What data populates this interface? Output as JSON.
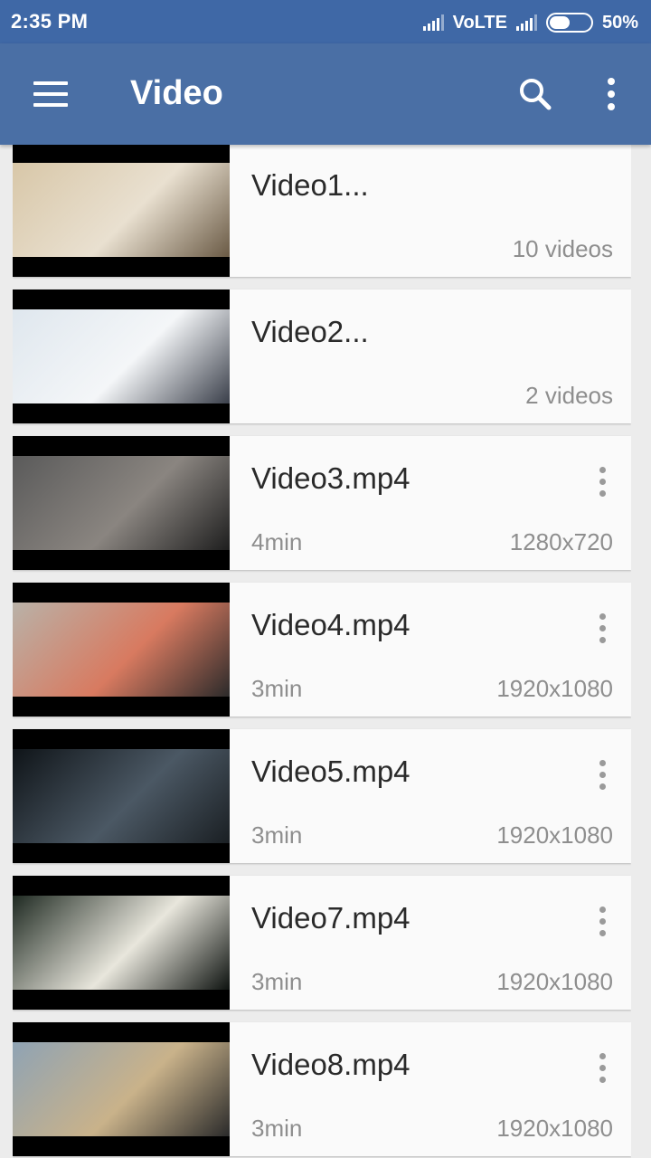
{
  "status_bar": {
    "time": "2:35 PM",
    "network": "VoLTE",
    "battery": "50%",
    "battery_level": 0.5
  },
  "app_bar": {
    "title": "Video",
    "menu_icon": "hamburger-menu-icon",
    "search_icon": "search-icon",
    "overflow_icon": "more-vert-icon"
  },
  "items": [
    {
      "title": "Video1...",
      "subtitle": "",
      "meta": "10 videos",
      "type": "folder",
      "colors": [
        "#d8c7a8",
        "#e9e0d0",
        "#6a5a45"
      ]
    },
    {
      "title": "Video2...",
      "subtitle": "",
      "meta": "2 videos",
      "type": "folder",
      "colors": [
        "#dfe7ee",
        "#f4f6f8",
        "#3a3f4a"
      ]
    },
    {
      "title": "Video3.mp4",
      "subtitle": "4min",
      "meta": "1280x720",
      "type": "file",
      "colors": [
        "#5a5a5a",
        "#8a8580",
        "#1e1e1e"
      ]
    },
    {
      "title": "Video4.mp4",
      "subtitle": "3min",
      "meta": "1920x1080",
      "type": "file",
      "colors": [
        "#b9b2a8",
        "#d87a60",
        "#2b2a2a"
      ]
    },
    {
      "title": "Video5.mp4",
      "subtitle": "3min",
      "meta": "1920x1080",
      "type": "file",
      "colors": [
        "#0f1418",
        "#4b5864",
        "#1a1f23"
      ]
    },
    {
      "title": "Video7.mp4",
      "subtitle": "3min",
      "meta": "1920x1080",
      "type": "file",
      "colors": [
        "#1f2a22",
        "#e8e6dc",
        "#0d120f"
      ]
    },
    {
      "title": "Video8.mp4",
      "subtitle": "3min",
      "meta": "1920x1080",
      "type": "file",
      "colors": [
        "#8fa3b4",
        "#c9b28a",
        "#2a2a2a"
      ]
    }
  ]
}
